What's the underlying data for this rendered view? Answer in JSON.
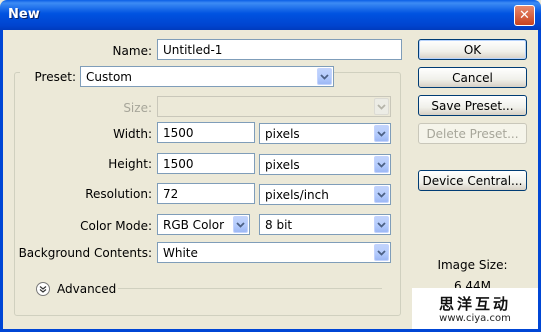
{
  "window": {
    "title": "New",
    "close_glyph": "✕"
  },
  "name": {
    "label": "Name:",
    "value": "Untitled-1"
  },
  "preset": {
    "label": "Preset:",
    "value": "Custom"
  },
  "size": {
    "label": "Size:",
    "value": ""
  },
  "width": {
    "label": "Width:",
    "value": "1500",
    "unit": "pixels"
  },
  "height": {
    "label": "Height:",
    "value": "1500",
    "unit": "pixels"
  },
  "resolution": {
    "label": "Resolution:",
    "value": "72",
    "unit": "pixels/inch"
  },
  "color_mode": {
    "label": "Color Mode:",
    "value": "RGB Color",
    "depth": "8 bit"
  },
  "background": {
    "label": "Background Contents:",
    "value": "White"
  },
  "advanced": {
    "label": "Advanced"
  },
  "buttons": {
    "ok": "OK",
    "cancel": "Cancel",
    "save_preset": "Save Preset...",
    "delete_preset": "Delete Preset...",
    "device_central": "Device Central..."
  },
  "image_size": {
    "label": "Image Size:",
    "value": "6.44M"
  },
  "watermark": {
    "main": "思洋互动",
    "url": "www.ciya.com"
  },
  "colors": {
    "titlebar": "#0053e1",
    "dialog_bg": "#ece9d8",
    "button_border": "#003c74"
  }
}
